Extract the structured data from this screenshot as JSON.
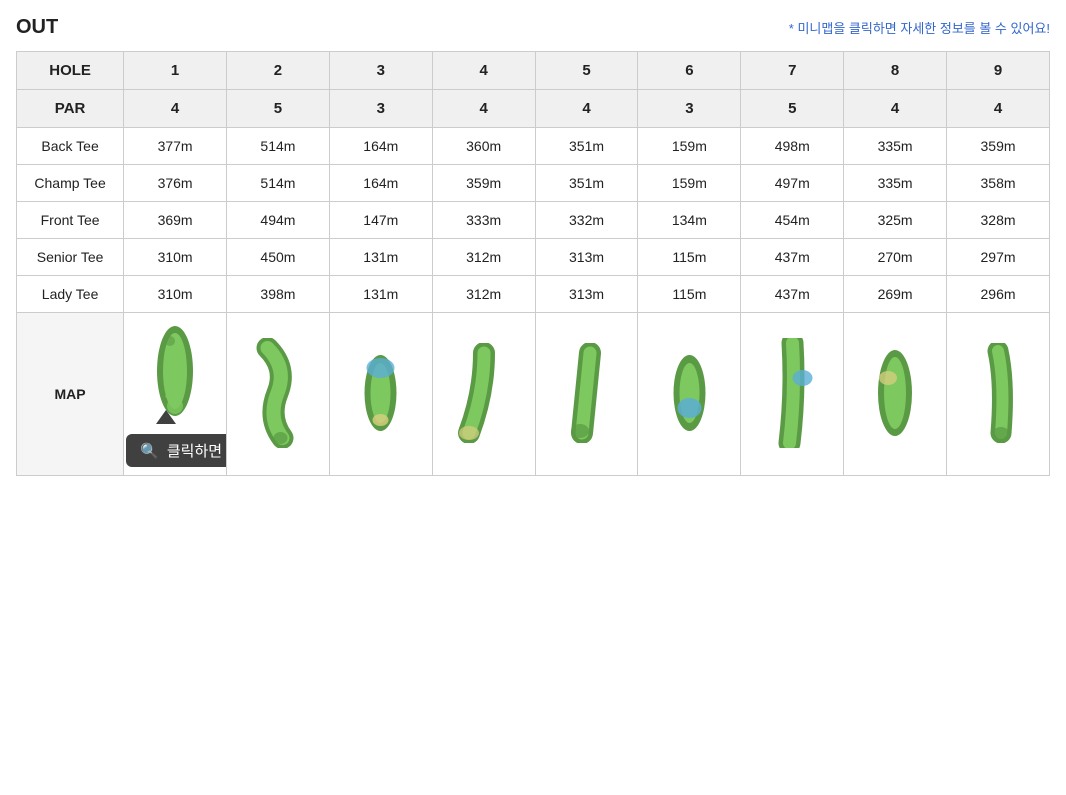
{
  "header": {
    "title": "OUT",
    "hint": "* 미니맵을 클릭하면 자세한 정보를 볼 수 있어요!"
  },
  "table": {
    "holes": [
      "1",
      "2",
      "3",
      "4",
      "5",
      "6",
      "7",
      "8",
      "9"
    ],
    "par": [
      "4",
      "5",
      "3",
      "4",
      "4",
      "3",
      "5",
      "4",
      "4"
    ],
    "rows": [
      {
        "label": "Back Tee",
        "values": [
          "377m",
          "514m",
          "164m",
          "360m",
          "351m",
          "159m",
          "498m",
          "335m",
          "359m"
        ]
      },
      {
        "label": "Champ Tee",
        "values": [
          "376m",
          "514m",
          "164m",
          "359m",
          "351m",
          "159m",
          "497m",
          "335m",
          "358m"
        ]
      },
      {
        "label": "Front Tee",
        "values": [
          "369m",
          "494m",
          "147m",
          "333m",
          "332m",
          "134m",
          "454m",
          "325m",
          "328m"
        ]
      },
      {
        "label": "Senior Tee",
        "values": [
          "310m",
          "450m",
          "131m",
          "312m",
          "313m",
          "115m",
          "437m",
          "270m",
          "297m"
        ]
      },
      {
        "label": "Lady Tee",
        "values": [
          "310m",
          "398m",
          "131m",
          "312m",
          "313m",
          "115m",
          "437m",
          "269m",
          "296m"
        ]
      }
    ],
    "mapLabel": "MAP"
  },
  "tooltip": {
    "icon": "🔍",
    "text": "클릭하면 자세한 정보를 볼 수 있어요!"
  },
  "colors": {
    "grass": "#4a8a3a",
    "fairway": "#6db85a",
    "water": "#4a9fd4",
    "sand": "#d4c87a",
    "rough": "#3a7a2a"
  }
}
